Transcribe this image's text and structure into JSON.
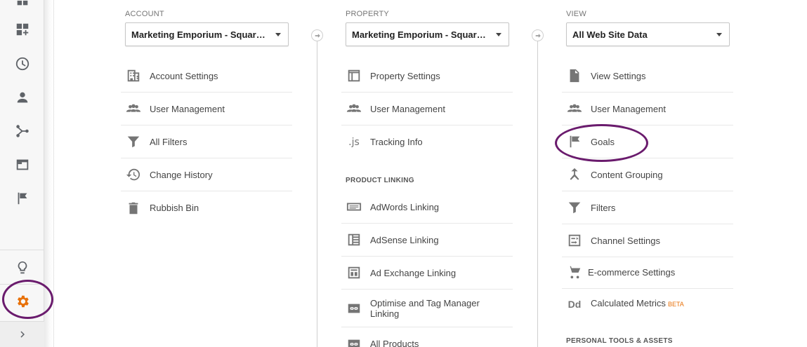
{
  "rail": {
    "items": [
      "home-icon",
      "customization-icon",
      "realtime-clock-icon",
      "audience-person-icon",
      "acquisition-icon",
      "behavior-icon",
      "conversions-flag-icon"
    ],
    "discover": "lightbulb-icon",
    "admin": "gear-icon",
    "admin_color": "#e8710a",
    "expand": "chevron-right-icon"
  },
  "account": {
    "header": "ACCOUNT",
    "selected": "Marketing Emporium - Squarespace",
    "items": [
      {
        "label": "Account Settings",
        "icon": "building-icon"
      },
      {
        "label": "User Management",
        "icon": "people-icon"
      },
      {
        "label": "All Filters",
        "icon": "filter-icon"
      },
      {
        "label": "Change History",
        "icon": "history-icon"
      },
      {
        "label": "Rubbish Bin",
        "icon": "trash-icon"
      }
    ]
  },
  "property": {
    "header": "PROPERTY",
    "selected": "Marketing Emporium - Squarespace",
    "items": [
      {
        "label": "Property Settings",
        "icon": "window-icon"
      },
      {
        "label": "User Management",
        "icon": "people-icon"
      },
      {
        "label": "Tracking Info",
        "icon": ".js"
      }
    ],
    "linking_header": "PRODUCT LINKING",
    "linking": [
      {
        "label": "AdWords Linking",
        "icon": "adwords-icon"
      },
      {
        "label": "AdSense Linking",
        "icon": "adsense-icon"
      },
      {
        "label": "Ad Exchange Linking",
        "icon": "adexchange-icon"
      },
      {
        "label": "Optimise and Tag Manager Linking",
        "icon": "link-icon"
      },
      {
        "label": "All Products",
        "icon": "link-icon"
      }
    ]
  },
  "view": {
    "header": "VIEW",
    "selected": "All Web Site Data",
    "items": [
      {
        "label": "View Settings",
        "icon": "document-icon"
      },
      {
        "label": "User Management",
        "icon": "people-icon"
      },
      {
        "label": "Goals",
        "icon": "flag-icon"
      },
      {
        "label": "Content Grouping",
        "icon": "merge-icon"
      },
      {
        "label": "Filters",
        "icon": "filter-icon"
      },
      {
        "label": "Channel Settings",
        "icon": "channel-icon"
      },
      {
        "label": "E-commerce Settings",
        "icon": "cart-icon"
      },
      {
        "label": "Calculated Metrics",
        "icon": "Dd",
        "badge": "BETA"
      }
    ],
    "personal_header": "PERSONAL TOOLS & ASSETS"
  },
  "colors": {
    "highlight_ring": "#6a1b6d",
    "beta": "#e8710a"
  }
}
